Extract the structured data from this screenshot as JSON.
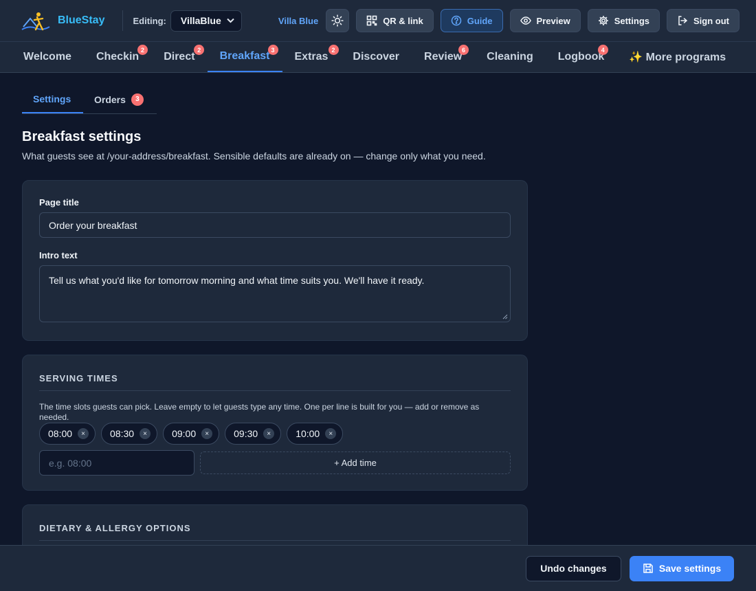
{
  "header": {
    "brand": "BlueStay",
    "editing_label": "Editing:",
    "property_select": "VillaBlue",
    "property_name": "Villa Blue",
    "buttons": {
      "qr": "QR & link",
      "guide": "Guide",
      "preview": "Preview",
      "settings": "Settings",
      "signout": "Sign out"
    }
  },
  "nav": {
    "items": [
      {
        "label": "Welcome",
        "badge": ""
      },
      {
        "label": "Checkin",
        "badge": "2"
      },
      {
        "label": "Direct",
        "badge": "2"
      },
      {
        "label": "Breakfast",
        "badge": "3"
      },
      {
        "label": "Extras",
        "badge": "2"
      },
      {
        "label": "Discover",
        "badge": ""
      },
      {
        "label": "Review",
        "badge": "6"
      },
      {
        "label": "Cleaning",
        "badge": ""
      },
      {
        "label": "Logbook",
        "badge": "4"
      },
      {
        "label": "✨ More programs",
        "badge": ""
      }
    ]
  },
  "subtabs": {
    "settings": "Settings",
    "orders": "Orders",
    "orders_count": "3"
  },
  "page": {
    "title": "Breakfast settings",
    "lede": "What guests see at /your-address/breakfast. Sensible defaults are already on — change only what you need."
  },
  "general": {
    "page_title_label": "Page title",
    "page_title_value": "Order your breakfast",
    "intro_label": "Intro text",
    "intro_value": "Tell us what you'd like for tomorrow morning and what time suits you. We'll have it ready."
  },
  "serving": {
    "title": "SERVING TIMES",
    "hint": "The time slots guests can pick. Leave empty to let guests type any time. One per line is built for you — add or remove as needed.",
    "times": [
      "08:00",
      "08:30",
      "09:00",
      "09:30",
      "10:00"
    ],
    "remove_glyph": "×",
    "input_placeholder": "e.g. 08:00",
    "add_label": "+ Add time"
  },
  "dietary": {
    "title": "DIETARY & ALLERGY OPTIONS"
  },
  "footer": {
    "undo": "Undo changes",
    "save": "Save settings"
  },
  "colors": {
    "accent": "#3b82f6",
    "badge": "#f87171",
    "background": "#0f172a",
    "surface": "#1e293b"
  }
}
